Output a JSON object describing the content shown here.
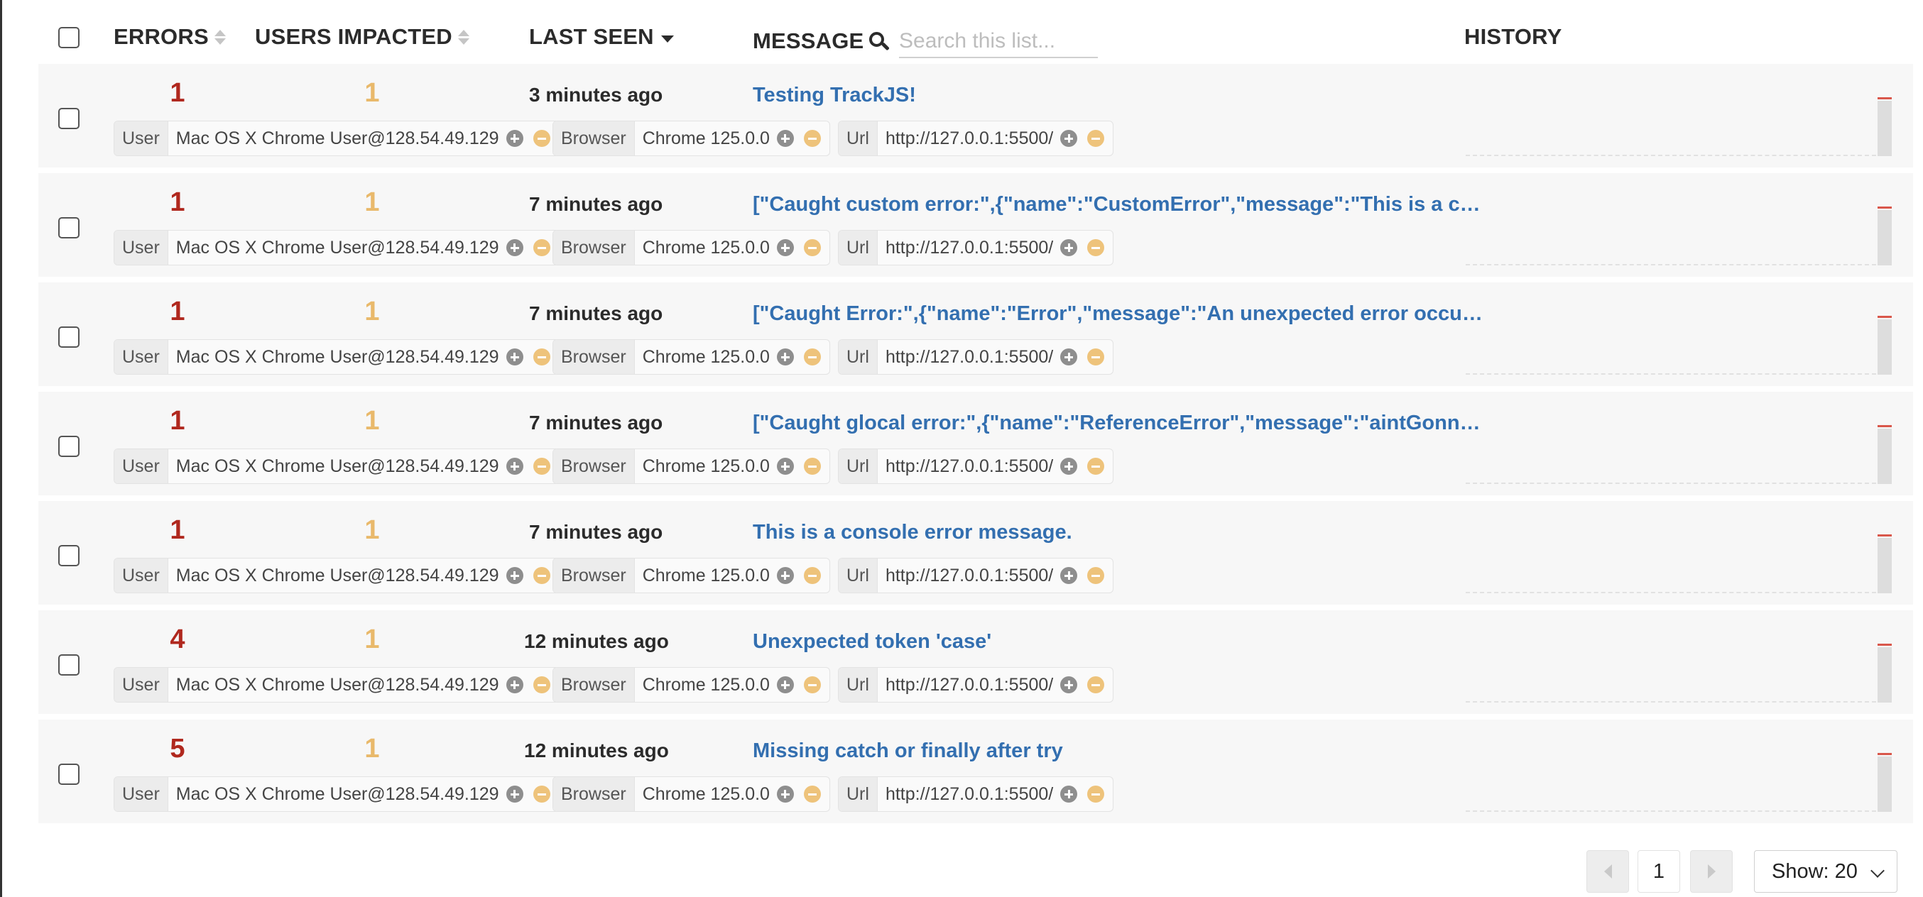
{
  "header": {
    "errors_label": "ERRORS",
    "users_label": "USERS IMPACTED",
    "last_seen_label": "LAST SEEN",
    "message_label": "MESSAGE",
    "history_label": "HISTORY",
    "search_placeholder": "Search this list..."
  },
  "tag_keys": {
    "user": "User",
    "browser": "Browser",
    "url": "Url"
  },
  "rows": [
    {
      "errors": "1",
      "users": "1",
      "last_seen": "3 minutes ago",
      "message": "Testing TrackJS!",
      "user": "Mac OS X Chrome User@128.54.49.129",
      "browser": "Chrome 125.0.0",
      "url": "http://127.0.0.1:5500/"
    },
    {
      "errors": "1",
      "users": "1",
      "last_seen": "7 minutes ago",
      "message": "[\"Caught custom error:\",{\"name\":\"CustomError\",\"message\":\"This is a custom error message.\"}]",
      "user": "Mac OS X Chrome User@128.54.49.129",
      "browser": "Chrome 125.0.0",
      "url": "http://127.0.0.1:5500/"
    },
    {
      "errors": "1",
      "users": "1",
      "last_seen": "7 minutes ago",
      "message": "[\"Caught Error:\",{\"name\":\"Error\",\"message\":\"An unexpected error occurred.\",\"stack\":\"\"}]",
      "user": "Mac OS X Chrome User@128.54.49.129",
      "browser": "Chrome 125.0.0",
      "url": "http://127.0.0.1:5500/"
    },
    {
      "errors": "1",
      "users": "1",
      "last_seen": "7 minutes ago",
      "message": "[\"Caught glocal error:\",{\"name\":\"ReferenceError\",\"message\":\"aintGonnaWork is not defined\"}]",
      "user": "Mac OS X Chrome User@128.54.49.129",
      "browser": "Chrome 125.0.0",
      "url": "http://127.0.0.1:5500/"
    },
    {
      "errors": "1",
      "users": "1",
      "last_seen": "7 minutes ago",
      "message": "This is a console error message.",
      "user": "Mac OS X Chrome User@128.54.49.129",
      "browser": "Chrome 125.0.0",
      "url": "http://127.0.0.1:5500/"
    },
    {
      "errors": "4",
      "users": "1",
      "last_seen": "12 minutes ago",
      "message": "Unexpected token 'case'",
      "user": "Mac OS X Chrome User@128.54.49.129",
      "browser": "Chrome 125.0.0",
      "url": "http://127.0.0.1:5500/"
    },
    {
      "errors": "5",
      "users": "1",
      "last_seen": "12 minutes ago",
      "message": "Missing catch or finally after try",
      "user": "Mac OS X Chrome User@128.54.49.129",
      "browser": "Chrome 125.0.0",
      "url": "http://127.0.0.1:5500/"
    }
  ],
  "pagination": {
    "current_page": "1",
    "show_label": "Show: 20"
  },
  "colors": {
    "error_count": "#b0281e",
    "user_count": "#e9b96b",
    "message_link": "#336fb0",
    "history_cap": "#d9574b"
  }
}
